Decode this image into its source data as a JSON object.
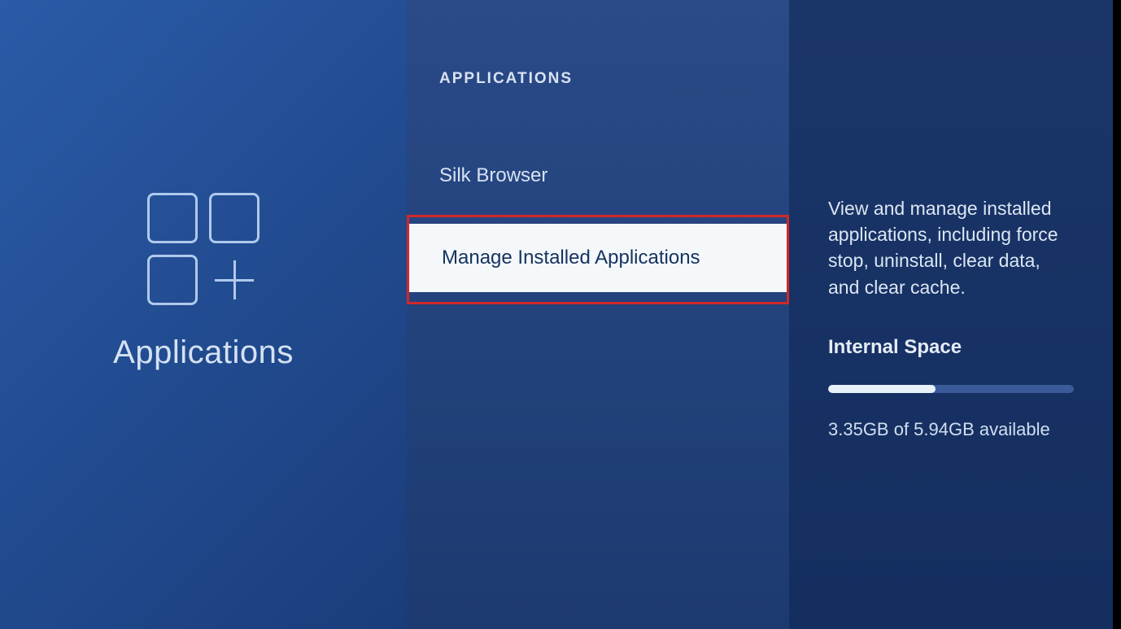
{
  "leftPanel": {
    "label": "Applications"
  },
  "middlePanel": {
    "header": "APPLICATIONS",
    "items": [
      {
        "label": "Silk Browser",
        "selected": false
      },
      {
        "label": "Manage Installed Applications",
        "selected": true
      }
    ]
  },
  "rightPanel": {
    "description": "View and manage installed applications, including force stop, uninstall, clear data, and clear cache.",
    "storageLabel": "Internal Space",
    "storageDetail": "3.35GB of 5.94GB available",
    "usedPercent": 43.6
  }
}
